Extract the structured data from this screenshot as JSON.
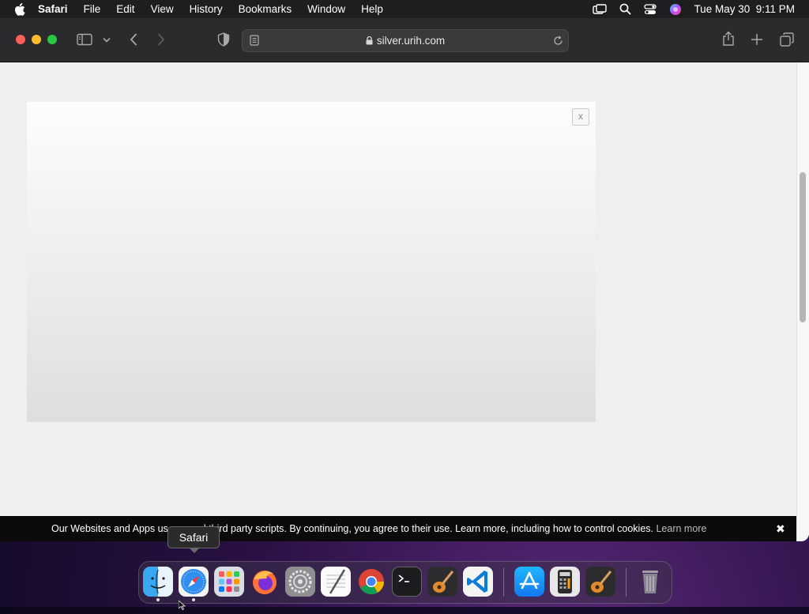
{
  "menubar": {
    "app_name": "Safari",
    "items": [
      "File",
      "Edit",
      "View",
      "History",
      "Bookmarks",
      "Window",
      "Help"
    ],
    "clock": "Tue May 30  9:11 PM"
  },
  "browser": {
    "url": "silver.urih.com"
  },
  "page": {
    "ad_close_label": "x",
    "cookie_text": "Our Websites and Apps us",
    "cookie_text_rest": "d third party scripts. By continuing, you agree to their use. Learn more, including how to control cookies.",
    "cookie_learn_more": "Learn more",
    "cookie_close": "✖"
  },
  "tooltip": {
    "label": "Safari"
  },
  "dock": {
    "apps": [
      "Finder",
      "Safari",
      "Launchpad",
      "Firefox",
      "System Settings",
      "TextEdit",
      "Chrome",
      "Terminal",
      "GarageBand",
      "Visual Studio Code",
      "App Store",
      "Calculator",
      "GarageBand",
      "Trash"
    ]
  },
  "colors": {
    "traffic_red": "#fe5f57",
    "traffic_yellow": "#febc2e",
    "traffic_green": "#28c840"
  }
}
